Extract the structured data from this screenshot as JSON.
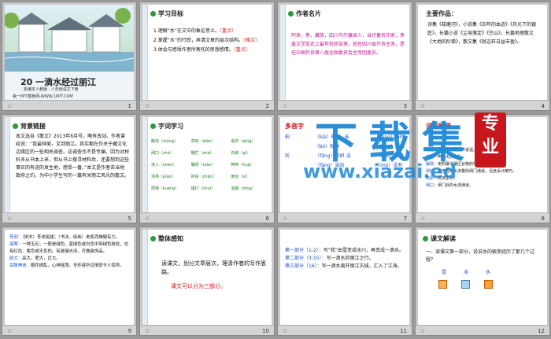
{
  "slides": [
    {
      "num": "1",
      "title": "20 一滴水经过丽江",
      "edition": "新编本人教版 · 八年级语文下册",
      "site": "第一PPT模板网-WWW.1PPT.COM"
    },
    {
      "num": "2",
      "heading": "学习目标",
      "items": [
        {
          "text": "1.理解“水”在文中的象征意义。",
          "tag": "（重点）"
        },
        {
          "text": "2.掌握“水”的行踪，弄清文章的层次结构。",
          "tag": "（难点）"
        },
        {
          "text": "3.体会与感悟作者所寄托的思想感情。",
          "tag": "（重点）"
        }
      ]
    },
    {
      "num": "3",
      "heading": "作者名片",
      "lines": [
        "阿来，男，藏族，四川马尔康县人，当代著名作家，茅盾文学奖史上最年轻获奖者，现任四川省作协主席，是任中国作协第八届全国委员会主席团委员。"
      ]
    },
    {
      "num": "4",
      "heading": "主要作品：",
      "lines": [
        "诗集《梭磨河》，小说集《旧年的血迹》《月光下的银匠》，长篇小说《尘埃落定》《空山》，长篇地理散文《大地的阶梯》，散文集《就这样日益丰盈》。"
      ]
    },
    {
      "num": "5",
      "heading": "背景链接",
      "lines": [
        "本文选自《散文》2013年6月号。略有改动。作者曾经说：“我最钟爱，又到丽江。其实都在作关于藏文化边缘区的一些相关调查。这调查也不是专编，因为对材料多从书本上来，但从书上搜寻材料后，还要想到这些事实的有迹的发生地，感受一番。”本文是作者去当地政府之约，为中小学生写的一篇有关丽江风光的散文。"
      ]
    },
    {
      "num": "6",
      "heading": "字词学习",
      "rows": [
        [
          "酿造（niàng）",
          "草甸（diàn）",
          "嘉庆（qìng）"
        ],
        [
          "闸口（zhá）",
          "栅栏（zhà）",
          "石砌（qì）"
        ],
        [
          "渗入（shèn）",
          "碾场（niǎn）",
          "哗哗（huā）"
        ],
        [
          "漂亮（piào）",
          "掺杂（chān）",
          "雨丝（sī）"
        ],
        [
          "哐啷（kuāng）",
          "捶打（chuí）",
          "消融（róng）"
        ]
      ]
    },
    {
      "num": "7",
      "heading": "多音字",
      "groups": [
        {
          "char": "柏",
          "items": [
            "（bǎi）柏树",
            "（bó）柏林"
          ]
        },
        {
          "char": "当",
          "items": [
            "（dāng）当时",
            "（dàng）上当"
          ]
        },
        {
          "char": "纺",
          "items": [
            "（fǎng）纺织",
            "（fàng）染坊"
          ]
        },
        {
          "char": "没",
          "items": [
            "（méi）没收",
            "（mò）没有"
          ]
        }
      ]
    },
    {
      "num": "8",
      "heading": "词语解释",
      "items": [
        {
          "word": "絮语：",
          "text": "连续不断地低声说话。"
        },
        {
          "word": "缔结：",
          "text": "声音大而杂乱。"
        },
        {
          "word": "碾场：",
          "text": "用石碾子碾压谷物的地方。"
        },
        {
          "word": "闸口：",
          "text": "用于控制水流量的闸门通道，沿途设计精巧。"
        },
        {
          "word": "高原：",
          "text": "高地生命。"
        },
        {
          "word": "闸口：",
          "text": "闸门处的水流通道。"
        }
      ]
    },
    {
      "num": "9",
      "lines": [
        {
          "word": "苍劲：",
          "text": "（树木）苍老挺拔；（书法、绘画）老练而雄健有力。"
        },
        {
          "word": "翡翠：",
          "text": "一种玉石，一般是绿色，蓝绿色或白色中带绿色斑纹，也有红色、紫色或无色的，有玻璃光泽，可做装饰品。"
        },
        {
          "word": "硕大：",
          "text": "高大，肥大，巨大。"
        },
        {
          "word": "目眩神迷：",
          "text": "眼花缭乱，心神摇荡。多形容所见情景令人惊异。"
        }
      ]
    },
    {
      "num": "10",
      "heading": "整体感知",
      "lines": [
        "读课文，划分文章层次，理清作者的写作思路。"
      ],
      "red": "课文可以分为三部分。"
    },
    {
      "num": "11",
      "parts": [
        {
          "label": "第一部分（1-2）：",
          "text": "写“我”由雪变成冰川，再变成一滴水。"
        },
        {
          "label": "第二部分（3-15）：",
          "text": "写一滴水的丽江之行。"
        },
        {
          "label": "第三部分（16）：",
          "text": "写一滴水离开丽江古城，汇入了江海。"
        }
      ]
    },
    {
      "num": "12",
      "heading": "课文解读",
      "lines": [
        "一、读课文第一部分，说说水的蜕变经历了那几个过程？"
      ],
      "labels": [
        "雪",
        "冰",
        "水"
      ]
    }
  ],
  "watermark": {
    "big": "下载集",
    "url": "www.xiazai.ed",
    "seal": "专业"
  }
}
